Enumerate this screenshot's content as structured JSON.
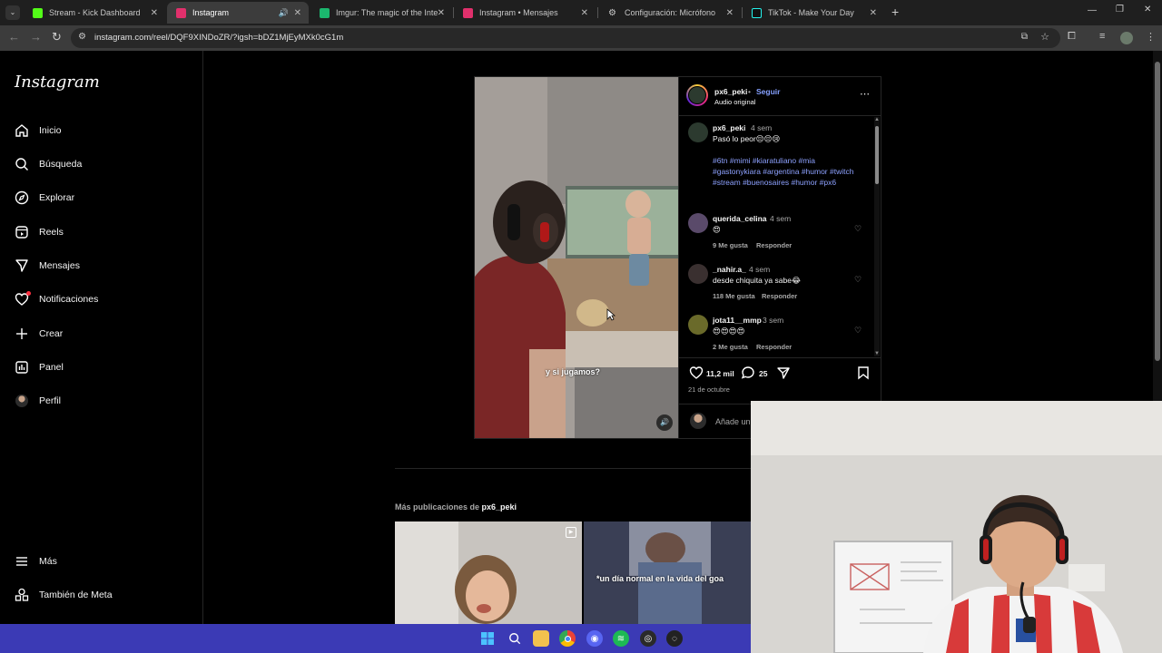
{
  "browser": {
    "tabs": [
      {
        "title": "Stream - Kick Dashboard",
        "color": "#53fc18"
      },
      {
        "title": "Instagram",
        "color": "#e1306c",
        "active": true
      },
      {
        "title": "Imgur: The magic of the Interne",
        "color": "#1bb76e"
      },
      {
        "title": "Instagram • Mensajes",
        "color": "#e1306c"
      },
      {
        "title": "Configuración: Micrófono",
        "color": "#8ab4f8"
      },
      {
        "title": "TikTok - Make Your Day",
        "color": "#ffffff"
      }
    ],
    "url": "instagram.com/reel/DQF9XINDoZR/?igsh=bDZ1MjEyMXk0cG1m"
  },
  "sidebar": {
    "logo": "Instagram",
    "items": [
      {
        "label": "Inicio",
        "icon": "home-icon"
      },
      {
        "label": "Búsqueda",
        "icon": "search-icon"
      },
      {
        "label": "Explorar",
        "icon": "compass-icon"
      },
      {
        "label": "Reels",
        "icon": "reels-icon"
      },
      {
        "label": "Mensajes",
        "icon": "messenger-icon"
      },
      {
        "label": "Notificaciones",
        "icon": "heart-icon"
      },
      {
        "label": "Crear",
        "icon": "plus-icon"
      },
      {
        "label": "Panel",
        "icon": "dashboard-icon"
      },
      {
        "label": "Perfil",
        "icon": "avatar-icon"
      }
    ],
    "more": "Más",
    "meta": "También de Meta"
  },
  "post": {
    "video_caption": "y si jugamos?",
    "username": "px6_peki",
    "follow": "Seguir",
    "audio": "Audio original",
    "caption": {
      "username": "px6_peki",
      "time": "4 sem",
      "text": "Pasó lo peor😔😔😢",
      "hashtags": "#6tn #mimi #kiaratuliano #mia #gastonykiara #argentina #humor #twitch #stream #buenosaires #humor #px6"
    },
    "comments": [
      {
        "username": "querida_celina",
        "time": "4 sem",
        "text": "😍",
        "likes": "9 Me gusta",
        "reply": "Responder"
      },
      {
        "username": "_nahir.a_",
        "time": "4 sem",
        "text": "desde chiquita ya sabe😂",
        "likes": "118 Me gusta",
        "reply": "Responder"
      },
      {
        "username": "jota11__mmp",
        "time": "3 sem",
        "text": "😍😍😍😍",
        "likes": "2 Me gusta",
        "reply": "Responder"
      }
    ],
    "likes_count": "11,2 mil",
    "comments_count": "25",
    "date": "21 de octubre",
    "add_comment_placeholder": "Añade un"
  },
  "more_posts": {
    "prefix": "Más publicaciones de ",
    "username": "px6_peki",
    "thumb2_caption": "*un día normal en la vida del goa"
  }
}
